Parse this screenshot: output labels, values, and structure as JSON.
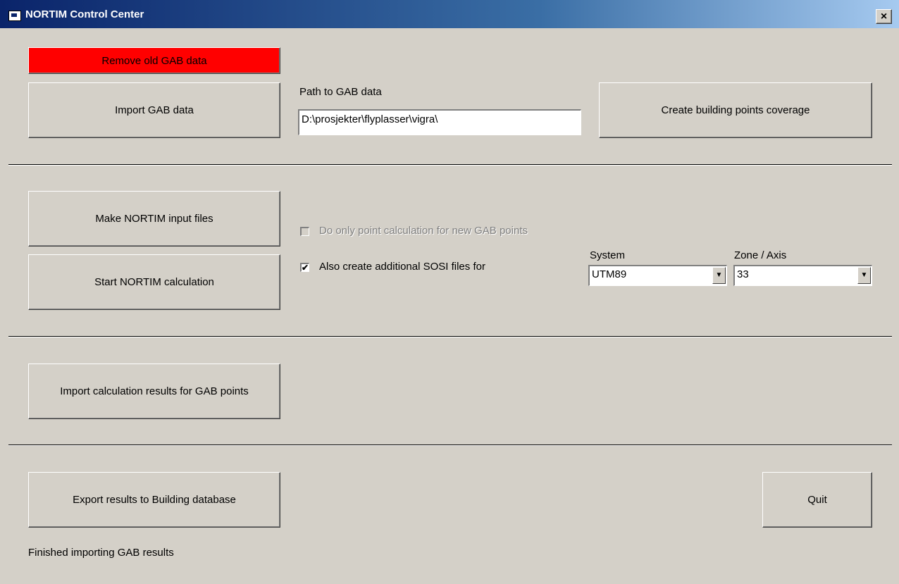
{
  "window": {
    "title": "NORTIM Control Center",
    "close_label": "×"
  },
  "section1": {
    "remove_button": "Remove old GAB data",
    "import_button": "Import GAB data",
    "path_label": "Path to GAB data",
    "path_value": "D:\\prosjekter\\flyplasser\\vigra\\",
    "create_button": "Create building points coverage"
  },
  "section2": {
    "make_button": "Make NORTIM input files",
    "start_button": "Start NORTIM calculation",
    "only_point_checkbox_label": "Do only point calculation for new GAB points",
    "only_point_checked": false,
    "sosi_checkbox_label": "Also create additional SOSI files for",
    "sosi_checked": true,
    "checkmark": "✔",
    "system_label": "System",
    "system_value": "UTM89",
    "zone_label": "Zone / Axis",
    "zone_value": "33",
    "dropdown_arrow": "▼"
  },
  "section3": {
    "import_results_button": "Import calculation results for GAB points"
  },
  "section4": {
    "export_button": "Export results to Building database",
    "quit_button": "Quit",
    "status_text": "Finished importing GAB results"
  },
  "colors": {
    "background": "#d4d0c8",
    "title_gradient_start": "#0a246a",
    "remove_button": "#ff0000"
  }
}
